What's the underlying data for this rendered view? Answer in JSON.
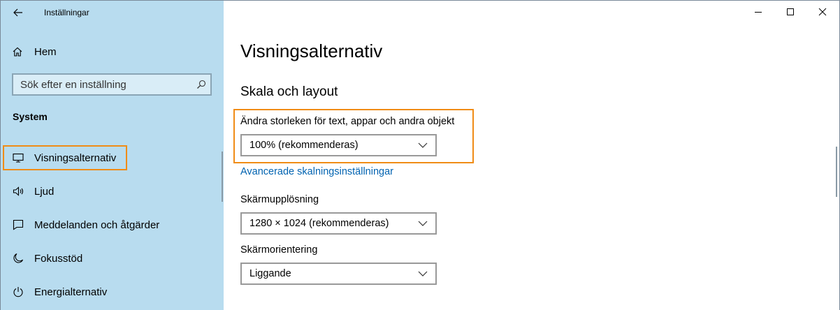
{
  "window": {
    "title": "Inställningar",
    "controls": [
      "minimize",
      "maximize",
      "close"
    ]
  },
  "sidebar": {
    "home_label": "Hem",
    "search_placeholder": "Sök efter en inställning",
    "section": "System",
    "items": [
      {
        "label": "Visningsalternativ",
        "icon": "monitor-icon",
        "active": true
      },
      {
        "label": "Ljud",
        "icon": "speaker-icon"
      },
      {
        "label": "Meddelanden och åtgärder",
        "icon": "notification-icon"
      },
      {
        "label": "Fokusstöd",
        "icon": "moon-icon"
      },
      {
        "label": "Energialternativ",
        "icon": "power-icon"
      }
    ]
  },
  "main": {
    "title": "Visningsalternativ",
    "section_title": "Skala och layout",
    "scale_label": "Ändra storleken för text, appar och andra objekt",
    "scale_value": "100% (rekommenderas)",
    "advanced_link": "Avancerade skalningsinställningar",
    "resolution_label": "Skärmupplösning",
    "resolution_value": "1280 × 1024 (rekommenderas)",
    "orientation_label": "Skärmorientering",
    "orientation_value": "Liggande"
  },
  "colors": {
    "sidebar_bg": "#b8dcef",
    "highlight": "#f08c16",
    "link": "#0063b1"
  }
}
